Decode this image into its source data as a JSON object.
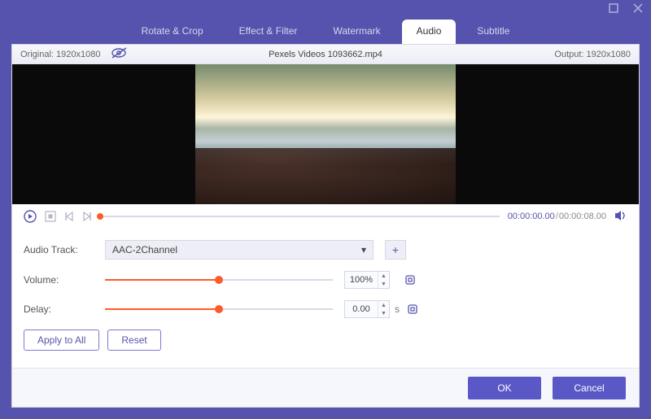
{
  "window": {
    "tabs": [
      "Rotate & Crop",
      "Effect & Filter",
      "Watermark",
      "Audio",
      "Subtitle"
    ],
    "active_tab": 3
  },
  "infobar": {
    "original_label": "Original:",
    "original_res": "1920x1080",
    "filename": "Pexels Videos 1093662.mp4",
    "output_label": "Output:",
    "output_res": "1920x1080"
  },
  "playback": {
    "current_time": "00:00:00.00",
    "total_time": "00:00:08.00"
  },
  "form": {
    "audio_track": {
      "label": "Audio Track:",
      "value": "AAC-2Channel"
    },
    "volume": {
      "label": "Volume:",
      "value": "100%",
      "percent": 50
    },
    "delay": {
      "label": "Delay:",
      "value": "0.00",
      "unit": "s",
      "percent": 50
    }
  },
  "buttons": {
    "apply_all": "Apply to All",
    "reset": "Reset",
    "ok": "OK",
    "cancel": "Cancel"
  }
}
